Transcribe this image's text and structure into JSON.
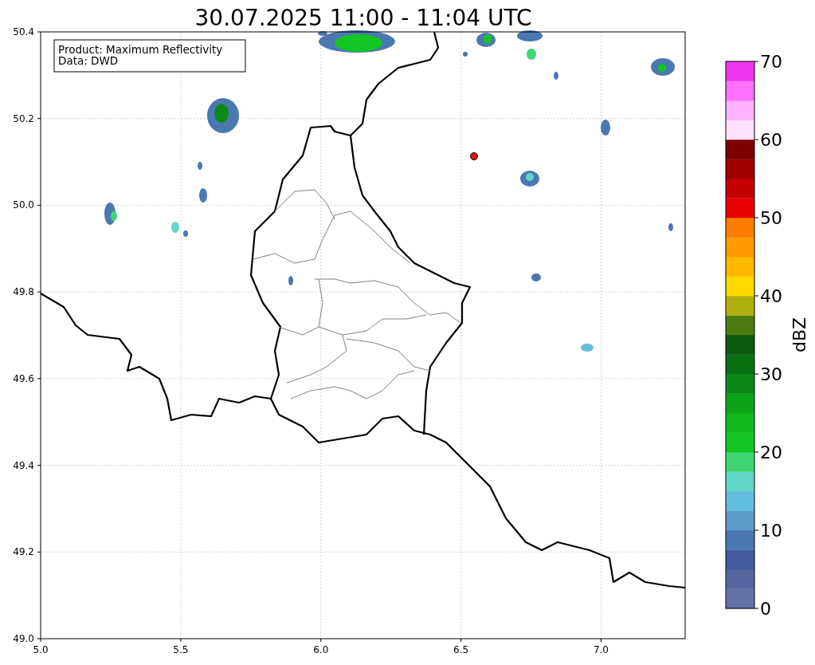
{
  "title": "30.07.2025 11:00 - 11:04 UTC",
  "info_box": {
    "lines": [
      "Product: Maximum Reflectivity",
      "Data: DWD"
    ]
  },
  "map": {
    "xticks": [
      "5.0",
      "5.5",
      "6.0",
      "6.5",
      "7.0"
    ],
    "yticks": [
      "50.4",
      "50.2",
      "50.0",
      "49.8",
      "49.6",
      "49.4",
      "49.2",
      "49.0"
    ]
  },
  "colorbar": {
    "label": "dBZ",
    "ticks": [
      "70",
      "60",
      "50",
      "40",
      "30",
      "20",
      "10",
      "0"
    ],
    "segments": [
      {
        "color": "#6272a4"
      },
      {
        "color": "#56689f"
      },
      {
        "color": "#435da0"
      },
      {
        "color": "#4a78b0"
      },
      {
        "color": "#5a9cc8"
      },
      {
        "color": "#62bedc"
      },
      {
        "color": "#62d6c6"
      },
      {
        "color": "#3fd673"
      },
      {
        "color": "#14c624"
      },
      {
        "color": "#10b81e"
      },
      {
        "color": "#0ea41a"
      },
      {
        "color": "#0c8a18"
      },
      {
        "color": "#0a7014"
      },
      {
        "color": "#0a5a10"
      },
      {
        "color": "#4a7a10"
      },
      {
        "color": "#b0b010"
      },
      {
        "color": "#ffd800"
      },
      {
        "color": "#ffb800"
      },
      {
        "color": "#ff9a00"
      },
      {
        "color": "#ff7c00"
      },
      {
        "color": "#e80000"
      },
      {
        "color": "#c40000"
      },
      {
        "color": "#a00000"
      },
      {
        "color": "#7c0000"
      },
      {
        "color": "#ffe0ff"
      },
      {
        "color": "#ffb0ff"
      },
      {
        "color": "#ff70ff"
      },
      {
        "color": "#ee36ee"
      }
    ]
  }
}
